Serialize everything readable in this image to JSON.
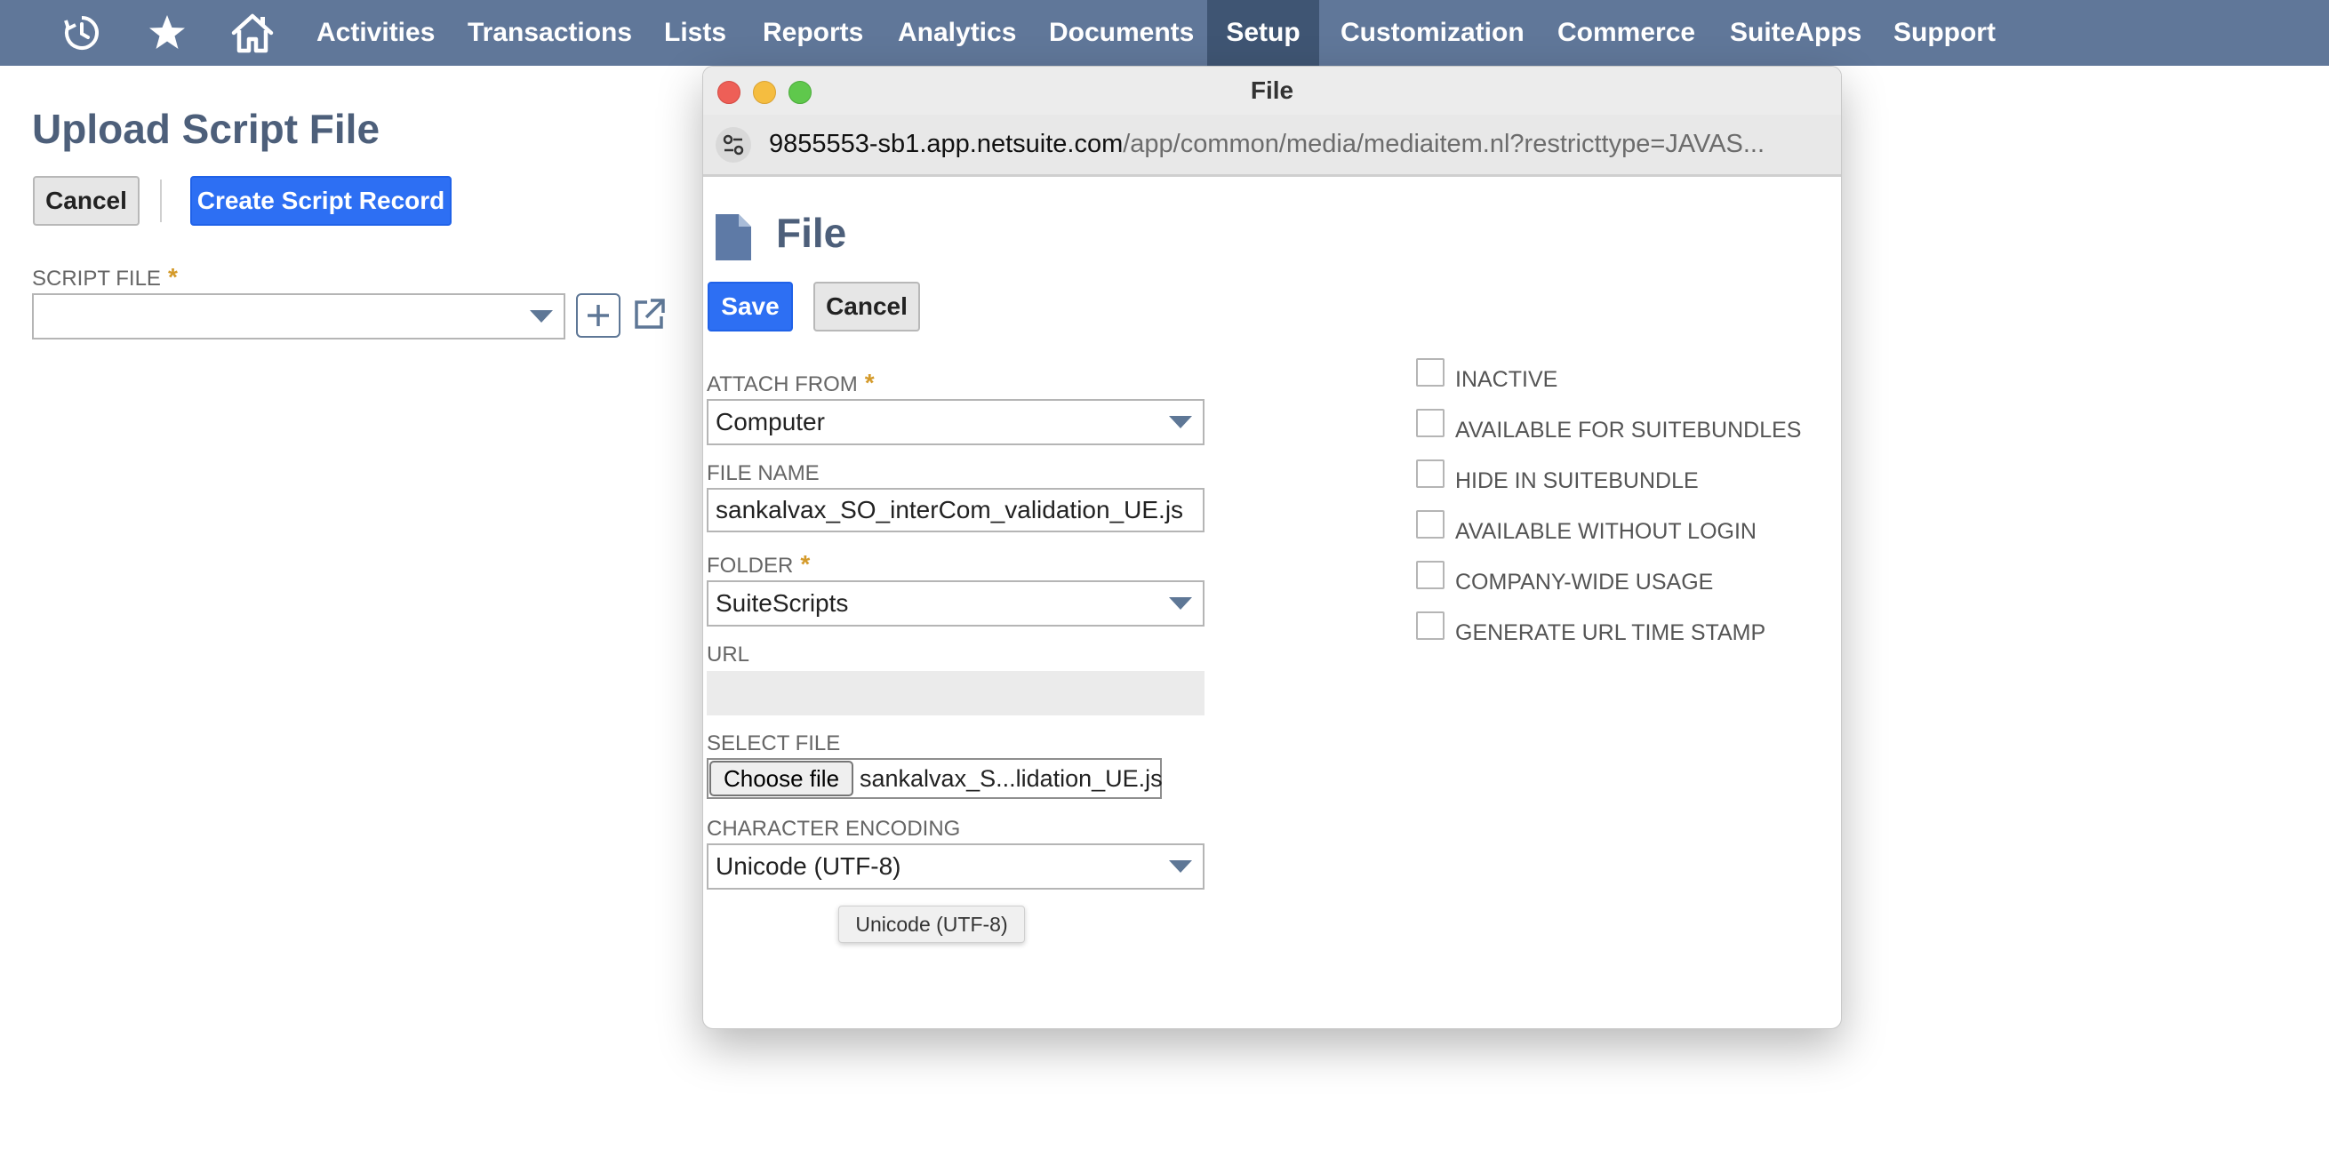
{
  "nav": {
    "icons": [
      "recent-history-icon",
      "star-icon",
      "home-icon"
    ],
    "items": [
      "Activities",
      "Transactions",
      "Lists",
      "Reports",
      "Analytics",
      "Documents",
      "Setup",
      "Customization",
      "Commerce",
      "SuiteApps",
      "Support"
    ],
    "active": "Setup"
  },
  "page": {
    "title": "Upload Script File",
    "cancel_label": "Cancel",
    "create_label": "Create Script Record",
    "script_file_label": "SCRIPT FILE",
    "required_mark": "*",
    "script_file_value": ""
  },
  "popup": {
    "window_title": "File",
    "url_host": "9855553-sb1.app.netsuite.com",
    "url_path": "/app/common/media/mediaitem.nl?restricttype=JAVAS...",
    "heading": "File",
    "save_label": "Save",
    "cancel_label": "Cancel",
    "attach_from_label": "ATTACH FROM",
    "attach_from_value": "Computer",
    "file_name_label": "FILE NAME",
    "file_name_value": "sankalvax_SO_interCom_validation_UE.js",
    "folder_label": "FOLDER",
    "folder_value": "SuiteScripts",
    "url_label": "URL",
    "url_value": "",
    "select_file_label": "SELECT FILE",
    "choose_file_label": "Choose file",
    "chosen_file_name": "sankalvax_S...lidation_UE.js",
    "encoding_label": "CHARACTER ENCODING",
    "encoding_value": "Unicode (UTF-8)",
    "tooltip": "Unicode (UTF-8)",
    "checkboxes": [
      "INACTIVE",
      "AVAILABLE FOR SUITEBUNDLES",
      "HIDE IN SUITEBUNDLE",
      "AVAILABLE WITHOUT LOGIN",
      "COMPANY-WIDE USAGE",
      "GENERATE URL TIME STAMP"
    ]
  },
  "colors": {
    "nav_bg": "#607799",
    "nav_active": "#3f5573",
    "primary_button": "#2d6ff3",
    "heading": "#4d5f7a",
    "required": "#d49a2a"
  }
}
